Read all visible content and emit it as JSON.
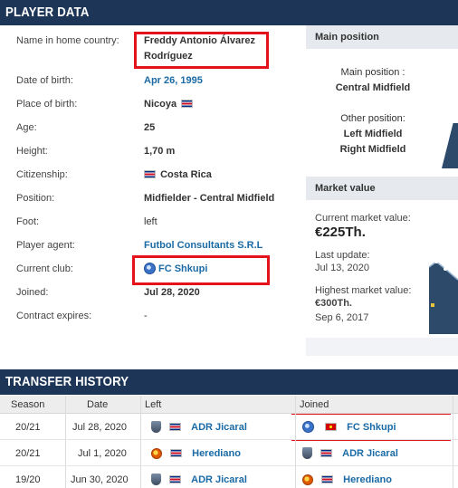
{
  "player_section": {
    "title": "PLAYER DATA",
    "rows": [
      {
        "label": "Name in home country:",
        "value_line1": "Freddy Antonio Álvarez",
        "value_line2": "Rodríguez"
      },
      {
        "label": "Date of birth:",
        "value": "Apr 26, 1995"
      },
      {
        "label": "Place of birth:",
        "value": "Nicoya"
      },
      {
        "label": "Age:",
        "value": "25"
      },
      {
        "label": "Height:",
        "value": "1,70 m"
      },
      {
        "label": "Citizenship:",
        "value": "Costa Rica"
      },
      {
        "label": "Position:",
        "value": "Midfielder - Central Midfield"
      },
      {
        "label": "Foot:",
        "value": "left"
      },
      {
        "label": "Player agent:",
        "value": "Futbol Consultants S.R.L"
      },
      {
        "label": "Current club:",
        "value": "FC Shkupi"
      },
      {
        "label": "Joined:",
        "value": "Jul 28, 2020"
      },
      {
        "label": "Contract expires:",
        "value": "-"
      }
    ]
  },
  "main_position": {
    "title": "Main position",
    "main_label": "Main position :",
    "main_value": "Central Midfield",
    "other_label": "Other position:",
    "other_values": [
      "Left Midfield",
      "Right Midfield"
    ]
  },
  "market_value": {
    "title": "Market value",
    "current_label": "Current market value:",
    "current_value": "€225Th.",
    "last_update_label": "Last update:",
    "last_update_value": "Jul 13, 2020",
    "highest_label": "Highest market value:",
    "highest_value": "€300Th.",
    "highest_date": "Sep 6, 2017"
  },
  "transfer_section": {
    "title": "TRANSFER HISTORY",
    "columns": [
      "Season",
      "Date",
      "Left",
      "Joined"
    ],
    "rows": [
      {
        "season": "20/21",
        "date": "Jul 28, 2020",
        "left": "ADR Jicaral",
        "joined": "FC Shkupi"
      },
      {
        "season": "20/21",
        "date": "Jul 1, 2020",
        "left": "Herediano",
        "joined": "ADR Jicaral"
      },
      {
        "season": "19/20",
        "date": "Jun 30, 2020",
        "left": "ADR Jicaral",
        "joined": "Herediano"
      }
    ]
  },
  "colors": {
    "header_bar": "#1d3557",
    "link": "#1a6aa6",
    "highlight": "#e3121b"
  }
}
